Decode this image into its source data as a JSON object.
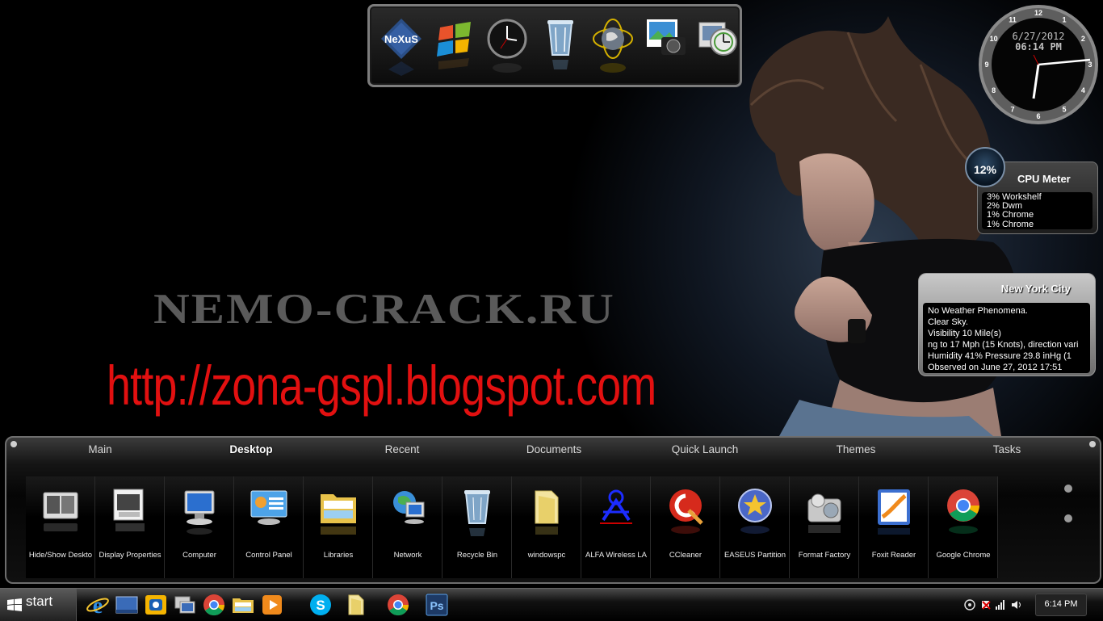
{
  "wallpaper": {
    "watermark": "NEMO-CRACK.RU",
    "url": "http://zona-gspl.blogspot.com"
  },
  "top_dock": {
    "icons": [
      "nexus-icon",
      "windows-logo-icon",
      "clock-icon",
      "recycle-bin-icon",
      "globe-icon",
      "camera-photo-icon",
      "stopwatch-icon"
    ]
  },
  "clock": {
    "date": "6/27/2012",
    "time": "06:14 PM",
    "numbers": [
      "12",
      "1",
      "2",
      "3",
      "4",
      "5",
      "6",
      "7",
      "8",
      "9",
      "10",
      "11"
    ]
  },
  "cpu_meter": {
    "percent": "12%",
    "title": "CPU Meter",
    "processes": [
      "3% Workshelf",
      "2% Dwm",
      "1% Chrome",
      "1% Chrome"
    ]
  },
  "weather": {
    "city": "New York City",
    "lines": [
      "No Weather Phenomena.",
      "Clear Sky.",
      "Visibility 10 Mile(s)",
      "ng to 17 Mph (15 Knots), direction vari",
      "Humidity 41%    Pressure 29.8 inHg (1",
      "Observed on June 27, 2012 17:51"
    ]
  },
  "main_dock": {
    "tabs": [
      "Main",
      "Desktop",
      "Recent",
      "Documents",
      "Quick Launch",
      "Themes",
      "Tasks"
    ],
    "active_tab": "Desktop",
    "items": [
      {
        "label": "Hide/Show Deskto",
        "icon": "desktop-toggle-icon"
      },
      {
        "label": "Display Properties",
        "icon": "display-properties-icon"
      },
      {
        "label": "Computer",
        "icon": "computer-icon"
      },
      {
        "label": "Control Panel",
        "icon": "control-panel-icon"
      },
      {
        "label": "Libraries",
        "icon": "libraries-icon"
      },
      {
        "label": "Network",
        "icon": "network-icon"
      },
      {
        "label": "Recycle Bin",
        "icon": "recycle-bin-icon"
      },
      {
        "label": "windowspc",
        "icon": "folder-icon"
      },
      {
        "label": "ALFA Wireless LA",
        "icon": "alfa-wireless-icon"
      },
      {
        "label": "CCleaner",
        "icon": "ccleaner-icon"
      },
      {
        "label": "EASEUS Partition",
        "icon": "easeus-partition-icon"
      },
      {
        "label": "Format Factory",
        "icon": "format-factory-icon"
      },
      {
        "label": "Foxit Reader",
        "icon": "foxit-reader-icon"
      },
      {
        "label": "Google Chrome",
        "icon": "chrome-icon"
      }
    ]
  },
  "taskbar": {
    "start_label": "start",
    "quick_launch": [
      "ie-icon",
      "show-desktop-icon",
      "outlook-icon",
      "switch-windows-icon",
      "chrome-icon",
      "explorer-icon",
      "media-player-icon"
    ],
    "running": [
      "skype-icon",
      "folder-icon",
      "chrome-icon",
      "photoshop-icon"
    ],
    "photoshop_label": "Ps",
    "tray_icons": [
      "shield-icon",
      "flag-icon",
      "signal-icon",
      "volume-icon"
    ],
    "time": "6:14 PM"
  },
  "colors": {
    "url_red": "#e21010",
    "watermark_gray": "#5a5a5a",
    "panel_dark": "#000000"
  }
}
